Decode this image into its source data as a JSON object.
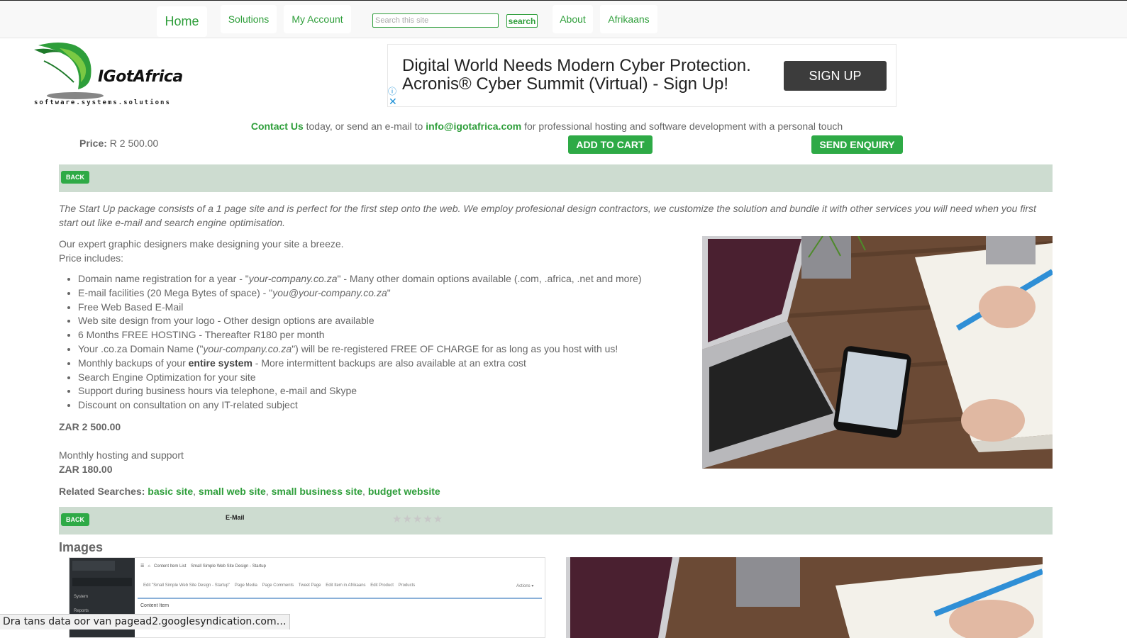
{
  "nav": {
    "home": "Home",
    "solutions": "Solutions",
    "my_account": "My Account",
    "search_placeholder": "Search this site",
    "search_button": "search",
    "about": "About",
    "afrikaans": "Afrikaans"
  },
  "logo": {
    "name": "IGotAfrica",
    "tagline": "software.systems.solutions"
  },
  "ad": {
    "line1": "Digital World Needs Modern Cyber Protection.",
    "line2": "Acronis® Cyber Summit (Virtual) - Sign Up!",
    "button": "SIGN UP",
    "info_icon": "info-icon",
    "close_icon": "close-icon"
  },
  "contact": {
    "contact_link": "Contact Us",
    "text1": " today, or send an e-mail to ",
    "email": "info@igotafrica.com",
    "text2": " for professional hosting and software development with a personal touch"
  },
  "price": {
    "label": "Price:",
    "value": " R 2 500.00"
  },
  "buttons": {
    "add_to_cart": "ADD TO CART",
    "send_enquiry": "SEND ENQUIRY",
    "back": "BACK"
  },
  "intro": "The Start Up package consists of a 1 page site and is perfect for the first step onto the web. We employ profesional design contractors, we customize the solution and bundle it with other services you will need when you first start out like e-mail and search engine optimisation.",
  "body": {
    "line1": "Our expert graphic designers make designing your site a breeze.",
    "line2": "Price includes:",
    "items": {
      "i1a": "Domain name registration for a year - \"",
      "i1b": "your-company.co.za",
      "i1c": "\" - Many other domain options available (.com, .africa, .net and more)",
      "i2a": "E-mail facilities (20 Mega Bytes of space) - \"",
      "i2b": "you@your-company.co.za",
      "i2c": "\"",
      "i3": "Free Web Based E-Mail",
      "i4": "Web site design from your logo - Other design options are available",
      "i5": "6 Months FREE HOSTING - Thereafter R180 per month",
      "i6a": "Your .co.za Domain Name (\"",
      "i6b": "your-company.co.za",
      "i6c": "\") will be re-registered FREE OF CHARGE for as long as you host with us!",
      "i7a": "Monthly backups of your ",
      "i7b": "entire system",
      "i7c": " - More intermittent backups are also available at an extra cost",
      "i8": "Search Engine Optimization for your site",
      "i9": "Support during business hours via telephone, e-mail and Skype",
      "i10": "Discount on consultation on any IT-related subject"
    },
    "price1": "ZAR 2 500.00",
    "monthly_label": "Monthly hosting and support",
    "price2": "ZAR 180.00"
  },
  "related": {
    "label": "Related Searches:",
    "links": [
      "basic site",
      "small web site",
      "small business site",
      "budget website"
    ]
  },
  "bottom_bar": {
    "email": "E-Mail",
    "stars": "★★★★★",
    "rating": 0
  },
  "images_title": "Images",
  "screenshot_thumb": {
    "nav1": "Content Item List",
    "nav2": "Small Simple Web Site Design - Startup",
    "tab1": "Edit \"Small Simple Web Site Design - Startup\"",
    "tab2": "Page Media",
    "tab3": "Page Comments",
    "tab4": "Tweet Page",
    "tab5": "Edit Item in Afrikaans",
    "tab6": "Edit Product",
    "tab7": "Products",
    "actions": "Actions ▾",
    "side1": "System",
    "side2": "Reports",
    "content": "Content Item"
  },
  "status": "Dra tans data oor van pagead2.googlesyndication.com…"
}
